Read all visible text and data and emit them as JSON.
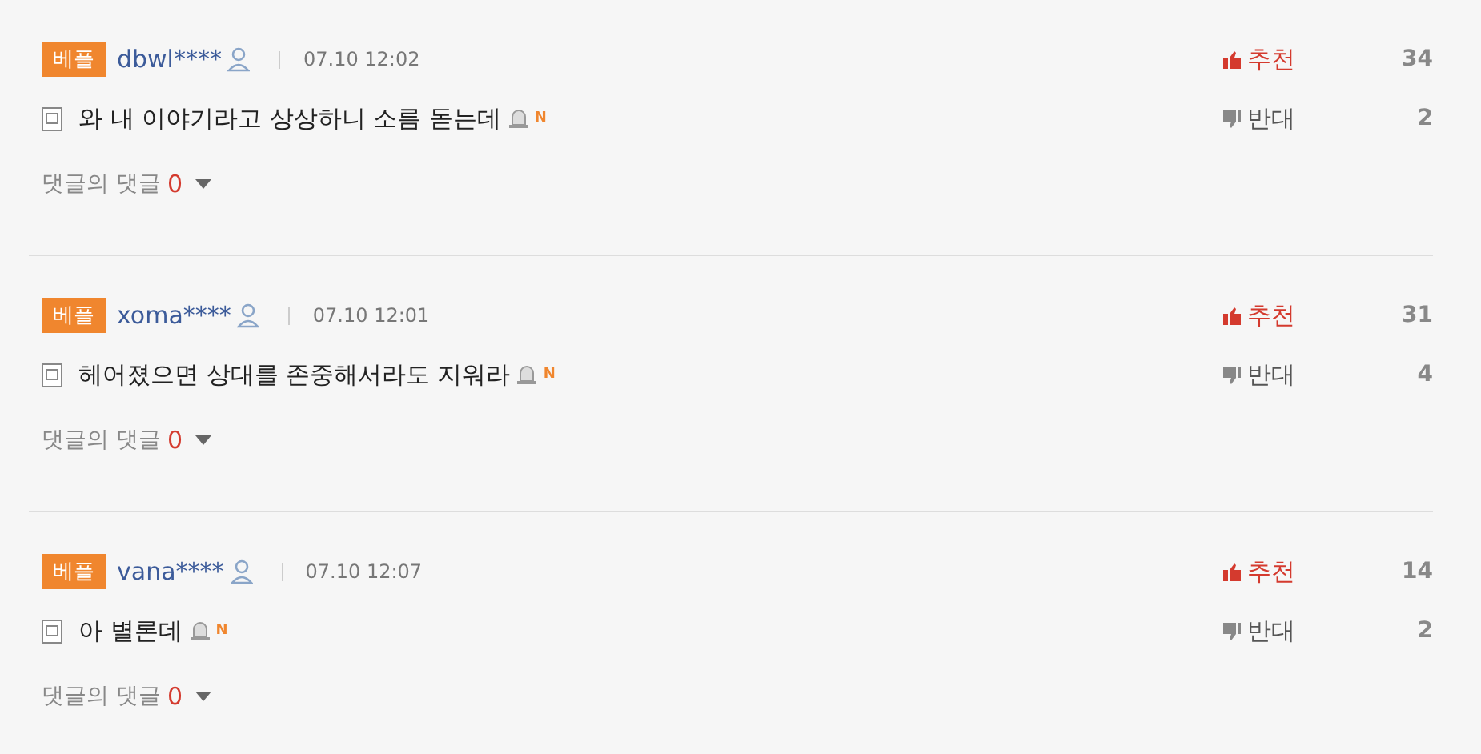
{
  "comments": [
    {
      "badge": "베플",
      "user": "dbwl****",
      "time": "07.10 12:02",
      "text": "와 내 이야기라고 상상하니 소름 돋는데",
      "new_mark": "N",
      "up_label": "추천",
      "up_count": "34",
      "down_label": "반대",
      "down_count": "2",
      "reply_label": "댓글의 댓글",
      "reply_count": "0"
    },
    {
      "badge": "베플",
      "user": "xoma****",
      "time": "07.10 12:01",
      "text": "헤어졌으면 상대를 존중해서라도 지워라",
      "new_mark": "N",
      "up_label": "추천",
      "up_count": "31",
      "down_label": "반대",
      "down_count": "4",
      "reply_label": "댓글의 댓글",
      "reply_count": "0"
    },
    {
      "badge": "베플",
      "user": "vana****",
      "time": "07.10 12:07",
      "text": "아 별론데",
      "new_mark": "N",
      "up_label": "추천",
      "up_count": "14",
      "down_label": "반대",
      "down_count": "2",
      "reply_label": "댓글의 댓글",
      "reply_count": "0"
    }
  ]
}
